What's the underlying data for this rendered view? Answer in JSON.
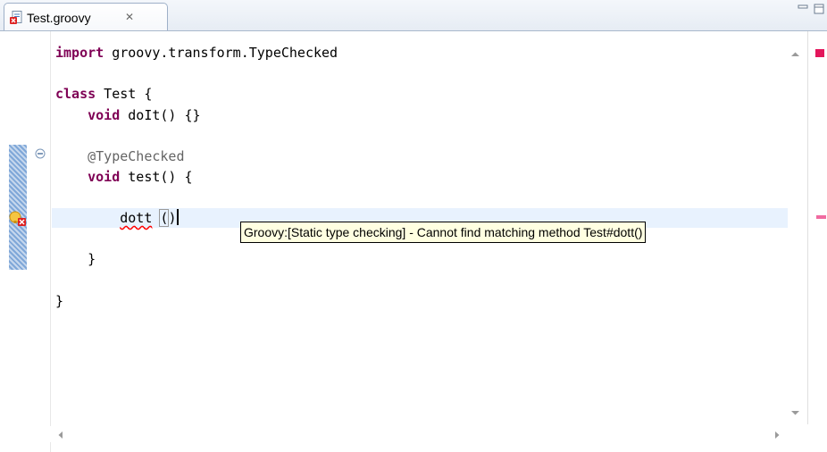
{
  "tab": {
    "title": "Test.groovy",
    "close_glyph": "✕"
  },
  "code_lines": {
    "l1": {
      "kw": "import",
      "text": " groovy.transform.TypeChecked"
    },
    "l3": {
      "kw": "class",
      "text": " Test {"
    },
    "l4": {
      "kw": "void",
      "text": " doIt() {}"
    },
    "l6": {
      "anno": "@TypeChecked"
    },
    "l7": {
      "kw": "void",
      "text": " test() {"
    },
    "l9": {
      "err_word": "dott",
      "space": " ",
      "paren_open": "(",
      "paren_close": ")"
    },
    "l11": {
      "text": "}"
    },
    "l13": {
      "text": "}"
    }
  },
  "tooltip": {
    "text": "Groovy:[Static type checking] - Cannot find matching method Test#dott()"
  },
  "icons": {
    "file": "groovy-file-error-icon",
    "minimize": "minimize-icon",
    "maximize": "maximize-icon",
    "fold": "fold-collapse-icon",
    "error": "quickfix-error-icon"
  },
  "colors": {
    "keyword": "#7f0055",
    "annotation": "#646464",
    "current_line": "#e8f2fe",
    "tooltip_bg": "#ffffe1",
    "error_underline": "#ff0000",
    "overview_error": "#e3165b"
  }
}
